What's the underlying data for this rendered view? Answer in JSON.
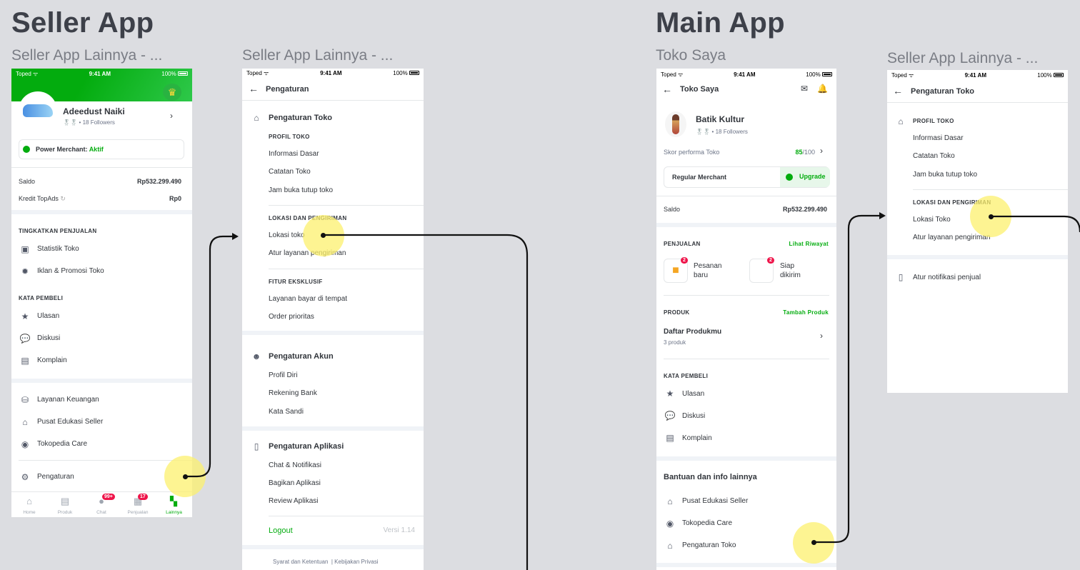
{
  "titles": {
    "seller": "Seller App",
    "main": "Main App"
  },
  "frame_labels": {
    "f1": "Seller App Lainnya - ...",
    "f2": "Seller App Lainnya - ...",
    "f3": "Toko Saya",
    "f4": "Seller App Lainnya - ..."
  },
  "status": {
    "carrier": "Toped",
    "time": "9:41 AM",
    "battery": "100%"
  },
  "phone1": {
    "profile_name": "Adeedust Naiki",
    "followers": "• 18 Followers",
    "pm_label": "Power Merchant:",
    "pm_status": "Aktif",
    "saldo_label": "Saldo",
    "saldo_value": "Rp532.299.490",
    "kredit_label": "Kredit TopAds",
    "kredit_value": "Rp0",
    "sec1": "TINGKATKAN PENJUALAN",
    "statistik": "Statistik Toko",
    "iklan": "Iklan & Promosi Toko",
    "sec2": "KATA PEMBELI",
    "ulasan": "Ulasan",
    "diskusi": "Diskusi",
    "komplain": "Komplain",
    "keuangan": "Layanan Keuangan",
    "edukasi": "Pusat Edukasi Seller",
    "care": "Tokopedia Care",
    "pengaturan": "Pengaturan",
    "nav": {
      "home": "Home",
      "produk": "Produk",
      "chat": "Chat",
      "penjualan": "Penjualan",
      "lainnya": "Lainnya"
    },
    "chat_badge": "99+",
    "penjualan_badge": "17"
  },
  "phone2": {
    "header": "Pengaturan",
    "toko_title": "Pengaturan Toko",
    "profil_cap": "PROFIL TOKO",
    "info": "Informasi Dasar",
    "catatan": "Catatan Toko",
    "jam": "Jam buka tutup toko",
    "lokasi_cap": "LOKASI DAN PENGIRIMAN",
    "lokasi": "Lokasi toko",
    "atur_kirim": "Atur layanan pengiriman",
    "fitur_cap": "FITUR EKSKLUSIF",
    "bayar": "Layanan bayar di tempat",
    "order": "Order prioritas",
    "akun_title": "Pengaturan Akun",
    "profil_diri": "Profil Diri",
    "rekening": "Rekening Bank",
    "sandi": "Kata Sandi",
    "aplikasi_title": "Pengaturan Aplikasi",
    "chat_notif": "Chat & Notifikasi",
    "bagikan": "Bagikan Aplikasi",
    "review": "Review Aplikasi",
    "logout": "Logout",
    "versi": "Versi 1.14",
    "syarat": "Syarat dan Ketentuan",
    "sep": "|",
    "privasi": "Kebijakan Privasi"
  },
  "phone3": {
    "header": "Toko Saya",
    "shop_name": "Batik Kultur",
    "followers": "• 18 Followers",
    "skor_label": "Skor performa Toko",
    "skor_value": "85",
    "skor_max": "/100",
    "merchant": "Regular Merchant",
    "upgrade": "Upgrade",
    "saldo_label": "Saldo",
    "saldo_value": "Rp532.299.490",
    "penjualan_cap": "PENJUALAN",
    "lihat_riwayat": "Lihat Riwayat",
    "pesanan_1": "Pesanan",
    "pesanan_2": "baru",
    "siap_1": "Siap",
    "siap_2": "dikirim",
    "badge_pesanan": "2",
    "badge_siap": "2",
    "produk_cap": "PRODUK",
    "tambah_produk": "Tambah Produk",
    "daftar": "Daftar Produkmu",
    "produk_count": "3 produk",
    "kata_cap": "KATA PEMBELI",
    "ulasan": "Ulasan",
    "diskusi": "Diskusi",
    "komplain": "Komplain",
    "bantuan": "Bantuan dan info lainnya",
    "edukasi": "Pusat Edukasi Seller",
    "care": "Tokopedia Care",
    "pengaturan_toko": "Pengaturan Toko"
  },
  "phone4": {
    "header": "Pengaturan Toko",
    "profil_cap": "PROFIL TOKO",
    "info": "Informasi Dasar",
    "catatan": "Catatan Toko",
    "jam": "Jam buka tutup toko",
    "lokasi_cap": "LOKASI DAN PENGIRIMAN",
    "lokasi": "Lokasi Toko",
    "atur_kirim": "Atur layanan pengiriman",
    "notif": "Atur notifikasi penjual"
  },
  "colors": {
    "brand_green": "#03ac0e",
    "highlight": "#fcf06e",
    "badge": "#ef144a"
  }
}
